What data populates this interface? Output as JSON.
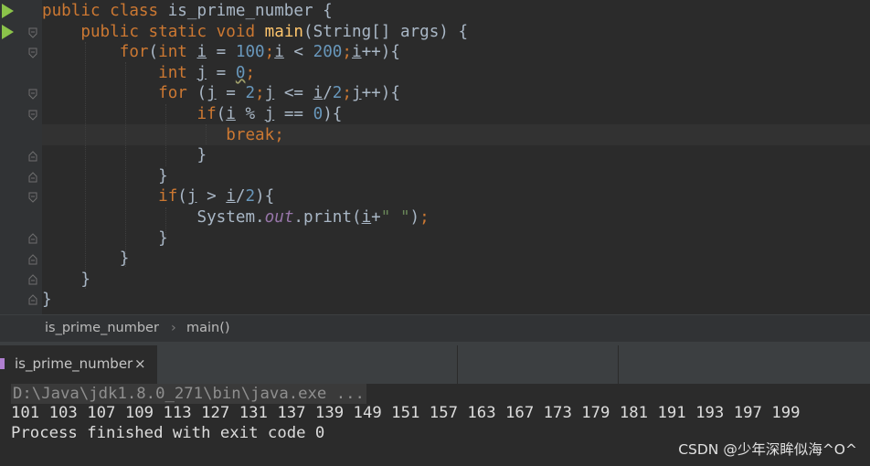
{
  "code": {
    "line1": {
      "kw": "public class",
      "name": " is_prime_number {"
    },
    "line2": {
      "kw": "public static void",
      "method": "main",
      "rest": "(String[] args) {"
    },
    "line3": {
      "for": "for",
      "open": "(",
      "int": "int",
      "var": "i",
      "eq": " = ",
      "start": "100",
      "semi1": ";",
      "i2": "i",
      "lt": " < ",
      "end": "200",
      "semi2": ";",
      "i3": "i",
      "inc": "++){"
    },
    "line4": {
      "int": "int",
      "var": "j",
      "eq": " = ",
      "val": "0",
      "semi": ";"
    },
    "line5": {
      "for": "for",
      "open": " (",
      "j1": "j",
      "eq": " = ",
      "two": "2",
      "semi1": ";",
      "j2": "j",
      "le": " <= ",
      "i": "i",
      "div": "/",
      "two2": "2",
      "semi2": ";",
      "j3": "j",
      "inc": "++){"
    },
    "line6": {
      "if": "if",
      "open": "(",
      "i": "i",
      "mod": " % ",
      "j": "j",
      "eq": " == ",
      "zero": "0",
      "close": "){"
    },
    "line7": {
      "brk": "break",
      "semi": ";"
    },
    "line8": "}",
    "line9": "}",
    "line10": {
      "if": "if",
      "open": "(",
      "j": "j",
      "gt": " > ",
      "i": "i",
      "div": "/",
      "two": "2",
      "close": "){"
    },
    "line11": {
      "sys": "System.",
      "out": "out",
      "print": ".print(",
      "i": "i",
      "plus": "+",
      "str": "\" \"",
      "close": ")",
      "semi": ";"
    },
    "line12": "}",
    "line13": "}",
    "line14": "}",
    "line15": "}"
  },
  "breadcrumb": {
    "class": "is_prime_number",
    "sep": "›",
    "method": "main()"
  },
  "run_tab": {
    "label": "is_prime_number",
    "close": "×"
  },
  "console": {
    "command": "D:\\Java\\jdk1.8.0_271\\bin\\java.exe ...",
    "output": "101 103 107 109 113 127 131 137 139 149 151 157 163 167 173 179 181 191 193 197 199",
    "exit": "Process finished with exit code 0"
  },
  "watermark": "CSDN @少年深眸似海^O^",
  "colors": {
    "keyword": "#cc7832",
    "number": "#6897bb",
    "string": "#6a8759",
    "method": "#ffc66d",
    "static_field": "#9876aa",
    "run_icon": "#8bc34a"
  },
  "icons": {
    "run": "run-icon",
    "fold": "fold-icon",
    "tab": "java-class-icon",
    "close": "close-icon"
  }
}
